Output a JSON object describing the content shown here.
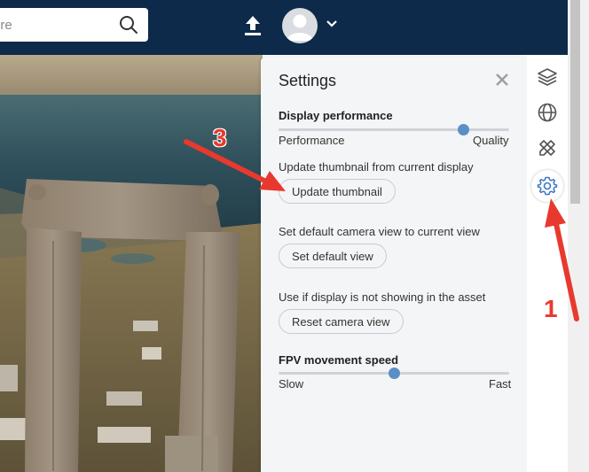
{
  "search": {
    "placeholder": "ere"
  },
  "settings": {
    "title": "Settings",
    "display_performance": {
      "heading": "Display performance",
      "left_label": "Performance",
      "right_label": "Quality",
      "value_fraction": 0.8
    },
    "thumbnail": {
      "description": "Update thumbnail from current display",
      "button": "Update thumbnail"
    },
    "default_view": {
      "description": "Set default camera view to current view",
      "button": "Set default view"
    },
    "reset_view": {
      "description": "Use if display is not showing in the asset",
      "button": "Reset camera view"
    },
    "fpv_speed": {
      "heading": "FPV movement speed",
      "left_label": "Slow",
      "right_label": "Fast",
      "value_fraction": 0.5
    }
  },
  "rail": {
    "icons": [
      "layers-icon",
      "globe-icon",
      "pencil-ruler-icon",
      "gear-icon"
    ],
    "active": "gear-icon"
  },
  "annotations": {
    "step_one": "1",
    "step_three": "3",
    "color": "#e8392f"
  },
  "colors": {
    "topbar": "#0e2a4a",
    "accent": "#5b8fc7"
  }
}
